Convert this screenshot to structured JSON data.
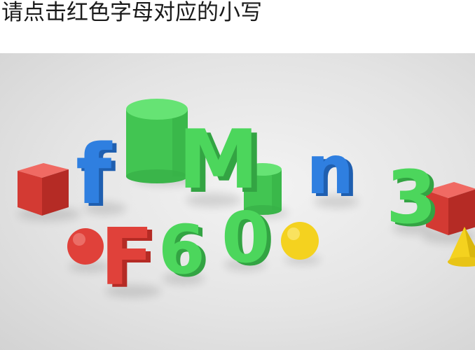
{
  "prompt": "请点击红色字母对应的小写",
  "scene": {
    "letters": [
      {
        "char": "f",
        "color": "blue"
      },
      {
        "char": "M",
        "color": "green"
      },
      {
        "char": "n",
        "color": "blue"
      },
      {
        "char": "3",
        "color": "green"
      },
      {
        "char": "F",
        "color": "red"
      },
      {
        "char": "6",
        "color": "green"
      },
      {
        "char": "0",
        "color": "green"
      }
    ],
    "colors": {
      "red": "#e0413a",
      "green": "#4cd65c",
      "blue": "#2f7fe0",
      "yellow": "#f4d21f"
    }
  }
}
